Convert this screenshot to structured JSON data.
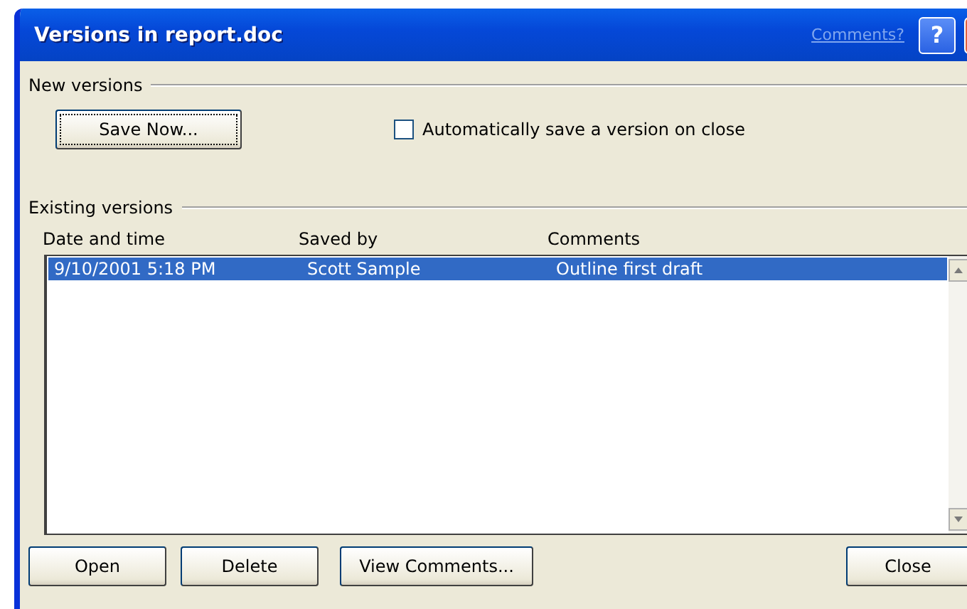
{
  "window": {
    "title": "Versions in report.doc",
    "comments_link": "Comments?",
    "help_button": "?"
  },
  "new_versions": {
    "heading": "New versions",
    "save_button": "Save Now...",
    "auto_save": {
      "label": "Automatically save a version on close",
      "checked": false
    }
  },
  "existing_versions": {
    "heading": "Existing versions",
    "columns": [
      "Date and time",
      "Saved by",
      "Comments"
    ],
    "rows": [
      {
        "date": "9/10/2001 5:18 PM",
        "saved_by": "Scott Sample",
        "comments": "Outline first draft",
        "selected": true
      }
    ]
  },
  "buttons": [
    "Open",
    "Delete",
    "View Comments..."
  ],
  "close_button": "Close"
}
